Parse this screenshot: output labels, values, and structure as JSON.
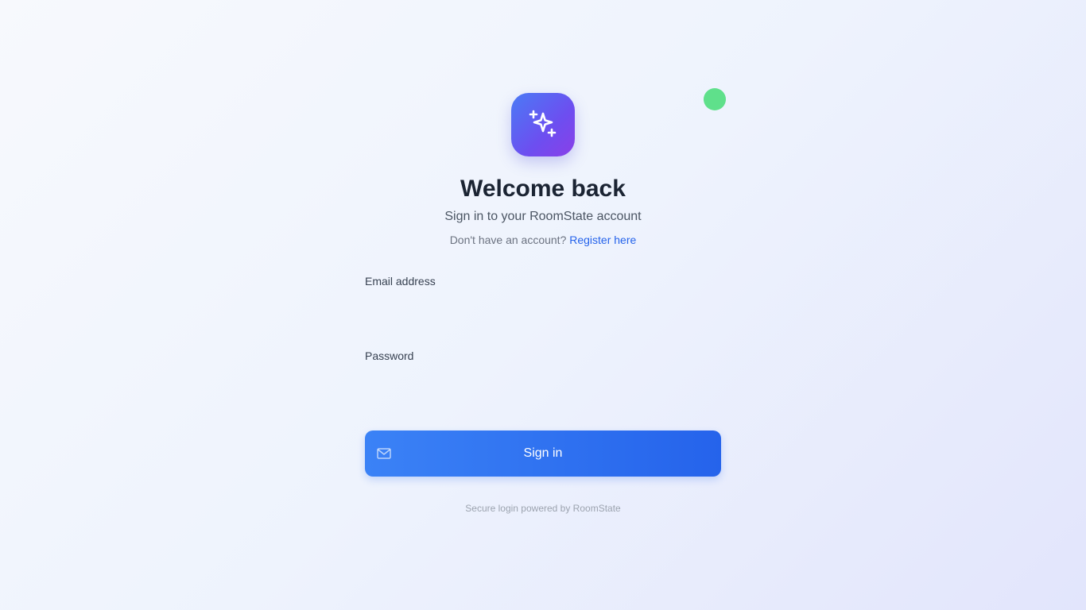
{
  "page": {
    "title": "Welcome back",
    "subtitle": "Sign in to your RoomState account"
  },
  "register": {
    "prompt": "Don't have an account?",
    "link_label": "Register here"
  },
  "form": {
    "email_label": "Email address",
    "email_value": "",
    "password_label": "Password",
    "password_value": ""
  },
  "signin_button": {
    "label": "Sign in",
    "icon": "mail-icon"
  },
  "footer": {
    "note": "Secure login powered by RoomState"
  },
  "icons": {
    "logo": "sparkles-icon",
    "status": "status-indicator"
  },
  "colors": {
    "accent": "#2563eb",
    "logo_gradient_start": "#4a7bf5",
    "logo_gradient_end": "#8a3fe8",
    "status_dot": "#5fe08b",
    "title": "#1b2433"
  }
}
